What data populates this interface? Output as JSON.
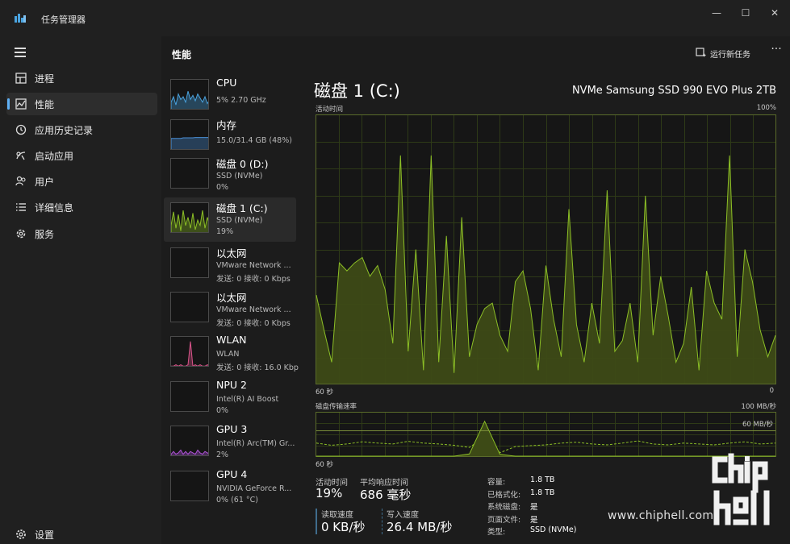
{
  "window": {
    "title": "任务管理器",
    "controls": [
      "—",
      "☐",
      "✕"
    ]
  },
  "sidebar": {
    "items": [
      {
        "label": "进程",
        "icon": "processes-icon"
      },
      {
        "label": "性能",
        "icon": "performance-icon"
      },
      {
        "label": "应用历史记录",
        "icon": "app-history-icon"
      },
      {
        "label": "启动应用",
        "icon": "startup-apps-icon"
      },
      {
        "label": "用户",
        "icon": "users-icon"
      },
      {
        "label": "详细信息",
        "icon": "details-icon"
      },
      {
        "label": "服务",
        "icon": "services-icon"
      }
    ],
    "settings_label": "设置"
  },
  "header": {
    "title": "性能",
    "run_task_label": "运行新任务",
    "more_label": "···"
  },
  "perf_list": [
    {
      "name": "CPU",
      "lines": [
        "5%  2.70 GHz"
      ],
      "color": "#4aa3df"
    },
    {
      "name": "内存",
      "lines": [
        "15.0/31.4 GB (48%)"
      ],
      "color": "#4a8fd6"
    },
    {
      "name": "磁盘 0 (D:)",
      "lines": [
        "SSD (NVMe)",
        "0%"
      ],
      "color": "#8cbf26"
    },
    {
      "name": "磁盘 1 (C:)",
      "lines": [
        "SSD (NVMe)",
        "19%"
      ],
      "color": "#8cbf26"
    },
    {
      "name": "以太网",
      "lines": [
        "VMware Network ...",
        "发送: 0 接收: 0 Kbps"
      ],
      "color": "#c9a227"
    },
    {
      "name": "以太网",
      "lines": [
        "VMware Network ...",
        "发送: 0 接收: 0 Kbps"
      ],
      "color": "#c9a227"
    },
    {
      "name": "WLAN",
      "lines": [
        "WLAN",
        "发送: 0 接收: 16.0 Kbp"
      ],
      "color": "#d9548a"
    },
    {
      "name": "NPU 2",
      "lines": [
        "Intel(R) AI Boost",
        "0%"
      ],
      "color": "#4aa3df"
    },
    {
      "name": "GPU 3",
      "lines": [
        "Intel(R) Arc(TM) Gr...",
        "2%"
      ],
      "color": "#b054d9"
    },
    {
      "name": "GPU 4",
      "lines": [
        "NVIDIA GeForce R...",
        "0% (61 °C)"
      ],
      "color": "#b054d9"
    }
  ],
  "detail": {
    "title": "磁盘 1 (C:)",
    "model": "NVMe Samsung SSD 990 EVO Plus 2TB",
    "active_chart": {
      "label": "活动时间",
      "max_label": "100%",
      "x_left": "60 秒",
      "x_right": "0"
    },
    "transfer_chart": {
      "label": "磁盘传输速率",
      "max_label": "100 MB/秒",
      "mid_label": "60 MB/秒",
      "x_left": "60 秒"
    },
    "stats": {
      "active_time_label": "活动时间",
      "active_time": "19%",
      "response_label": "平均响应时间",
      "response": "686 毫秒",
      "read_label": "读取速度",
      "read": "0 KB/秒",
      "write_label": "写入速度",
      "write": "26.4 MB/秒"
    },
    "props": [
      {
        "label": "容量:",
        "value": "1.8 TB"
      },
      {
        "label": "已格式化:",
        "value": "1.8 TB"
      },
      {
        "label": "系统磁盘:",
        "value": "是"
      },
      {
        "label": "页面文件:",
        "value": "是"
      },
      {
        "label": "类型:",
        "value": "SSD (NVMe)"
      }
    ]
  },
  "watermark": {
    "logo_text": "chip hell",
    "url": "www.chiphell.com"
  },
  "colors": {
    "accent": "#5fb0f5",
    "disk": "#8cbf26",
    "disk_fill": "#3d4a16"
  },
  "chart_data": [
    {
      "type": "area",
      "title": "活动时间",
      "ylabel": "",
      "ylim": [
        0,
        100
      ],
      "x_unit": "seconds ago",
      "x": [
        60,
        59,
        58,
        57,
        56,
        55,
        54,
        53,
        52,
        51,
        50,
        49,
        48,
        47,
        46,
        45,
        44,
        43,
        42,
        41,
        40,
        39,
        38,
        37,
        36,
        35,
        34,
        33,
        32,
        31,
        30,
        29,
        28,
        27,
        26,
        25,
        24,
        23,
        22,
        21,
        20,
        19,
        18,
        17,
        16,
        15,
        14,
        13,
        12,
        11,
        10,
        9,
        8,
        7,
        6,
        5,
        4,
        3,
        2,
        1,
        0
      ],
      "series": [
        {
          "values": [
            33,
            20,
            8,
            45,
            42,
            45,
            47,
            40,
            44,
            35,
            15,
            85,
            12,
            50,
            5,
            85,
            8,
            55,
            4,
            62,
            10,
            22,
            28,
            30,
            18,
            12,
            38,
            42,
            28,
            5,
            44,
            24,
            10,
            65,
            22,
            8,
            30,
            15,
            72,
            12,
            16,
            30,
            8,
            70,
            18,
            40,
            25,
            8,
            15,
            36,
            5,
            42,
            30,
            24,
            85,
            10,
            50,
            38,
            20,
            10,
            18
          ]
        }
      ]
    },
    {
      "type": "line",
      "title": "磁盘传输速率",
      "ylim": [
        0,
        100
      ],
      "ylabel": "",
      "x_unit": "seconds ago",
      "x": [
        60,
        58,
        56,
        54,
        52,
        50,
        48,
        46,
        44,
        42,
        40,
        38,
        36,
        34,
        32,
        30,
        28,
        26,
        24,
        22,
        20,
        18,
        16,
        14,
        12,
        10,
        8,
        6,
        4,
        2,
        0
      ],
      "series": [
        {
          "values": [
            30,
            25,
            28,
            33,
            30,
            28,
            34,
            30,
            28,
            25,
            20,
            45,
            8,
            22,
            24,
            26,
            30,
            32,
            28,
            26,
            30,
            35,
            28,
            26,
            30,
            28,
            26,
            30,
            33,
            28,
            30
          ]
        },
        {
          "values": [
            0,
            0,
            0,
            0,
            0,
            0,
            0,
            0,
            0,
            0,
            5,
            80,
            4,
            0,
            0,
            0,
            0,
            0,
            0,
            0,
            0,
            0,
            0,
            0,
            0,
            0,
            0,
            0,
            0,
            0,
            0
          ]
        }
      ]
    }
  ]
}
